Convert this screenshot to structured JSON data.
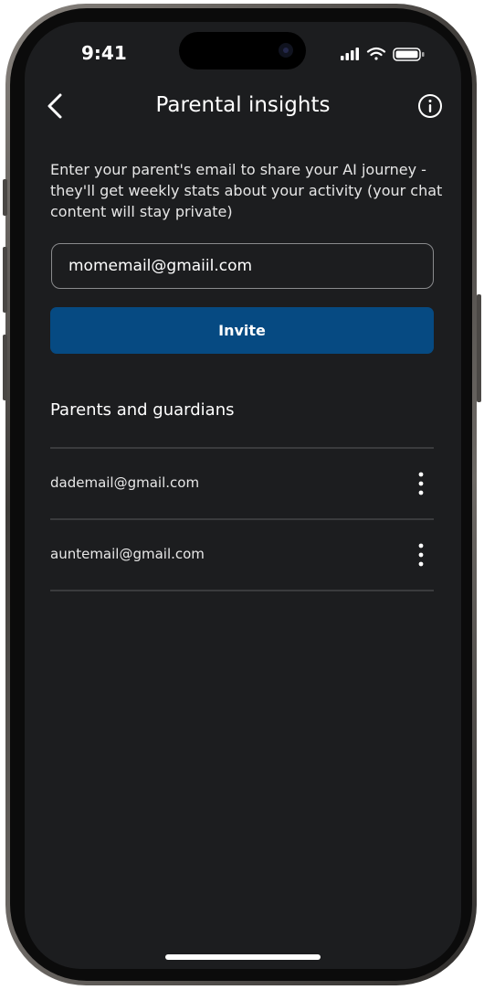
{
  "status_bar": {
    "time": "9:41",
    "icons": [
      "cellular-signal-icon",
      "wifi-icon",
      "battery-icon"
    ]
  },
  "nav": {
    "back_icon": "chevron-left-icon",
    "title": "Parental insights",
    "info_icon": "info-circle-icon"
  },
  "description": "Enter your parent's email to share your AI journey - they'll get weekly stats about your activity (your chat content will stay private)",
  "email_input": {
    "value": "momemail@gmaiil.com"
  },
  "invite_label": "Invite",
  "guardians": {
    "title": "Parents and guardians",
    "items": [
      {
        "email": "dademail@gmail.com",
        "menu_icon": "more-vertical-icon"
      },
      {
        "email": "auntemail@gmail.com",
        "menu_icon": "more-vertical-icon"
      }
    ]
  },
  "colors": {
    "background": "#1c1d1f",
    "accent": "#064a82",
    "divider": "#3a3b3d",
    "text": "#ffffff"
  }
}
